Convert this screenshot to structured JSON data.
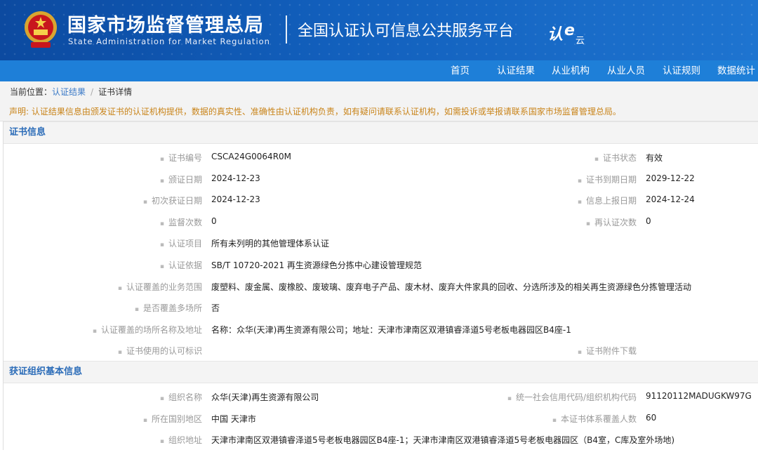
{
  "header": {
    "agency_cn": "国家市场监督管理总局",
    "agency_en": "State Administration  for  Market Regulation",
    "platform": "全国认证认可信息公共服务平台",
    "platform_logo_text": "认e云"
  },
  "nav": [
    "首页",
    "认证结果",
    "从业机构",
    "从业人员",
    "认证规则",
    "数据统计"
  ],
  "breadcrumb": {
    "prefix": "当前位置：",
    "link": "认证结果",
    "sep": "/",
    "current": "证书详情"
  },
  "notice": "声明: 认证结果信息由颁发证书的认证机构提供，数据的真实性、准确性由认证机构负责，如有疑问请联系认证机构，如需投诉或举报请联系国家市场监督管理总局。",
  "cert_section": {
    "title": "证书信息",
    "rows": [
      {
        "label": "证书编号",
        "value": "CSCA24G0064R0M",
        "label2": "证书状态",
        "value2": "有效"
      },
      {
        "label": "颁证日期",
        "value": "2024-12-23",
        "label2": "证书到期日期",
        "value2": "2029-12-22"
      },
      {
        "label": "初次获证日期",
        "value": "2024-12-23",
        "label2": "信息上报日期",
        "value2": "2024-12-24"
      },
      {
        "label": "监督次数",
        "value": "0",
        "label2": "再认证次数",
        "value2": "0"
      },
      {
        "label": "认证项目",
        "value": "所有未列明的其他管理体系认证"
      },
      {
        "label": "认证依据",
        "value": "SB/T 10720-2021 再生资源绿色分拣中心建设管理规范"
      },
      {
        "label": "认证覆盖的业务范围",
        "value": "废塑料、废金属、废橡胶、废玻璃、废弃电子产品、废木材、废弃大件家具的回收、分选所涉及的相关再生资源绿色分拣管理活动"
      },
      {
        "label": "是否覆盖多场所",
        "value": "否"
      },
      {
        "label": "认证覆盖的场所名称及地址",
        "value": "名称：众华(天津)再生资源有限公司；地址：天津市津南区双港镇睿泽道5号老板电器园区B4座-1"
      },
      {
        "label": "证书使用的认可标识",
        "value": "",
        "label2": "证书附件下载",
        "value2": ""
      }
    ]
  },
  "org_section": {
    "title": "获证组织基本信息",
    "rows": [
      {
        "label": "组织名称",
        "value": "众华(天津)再生资源有限公司",
        "label2": "统一社会信用代码/组织机构代码",
        "value2": "91120112MADUGKW97G"
      },
      {
        "label": "所在国别地区",
        "value": "中国 天津市",
        "label2": "本证书体系覆盖人数",
        "value2": "60"
      },
      {
        "label": "组织地址",
        "value": "天津市津南区双港镇睿泽道5号老板电器园区B4座-1；天津市津南区双港镇睿泽道5号老板电器园区（B4室，C库及室外场地)"
      }
    ]
  },
  "colors": {
    "banner": "#0c4aa0",
    "nav": "#1e7fd8",
    "section_title": "#2b6cb8",
    "notice": "#c9841a",
    "link": "#3b7ac7"
  }
}
